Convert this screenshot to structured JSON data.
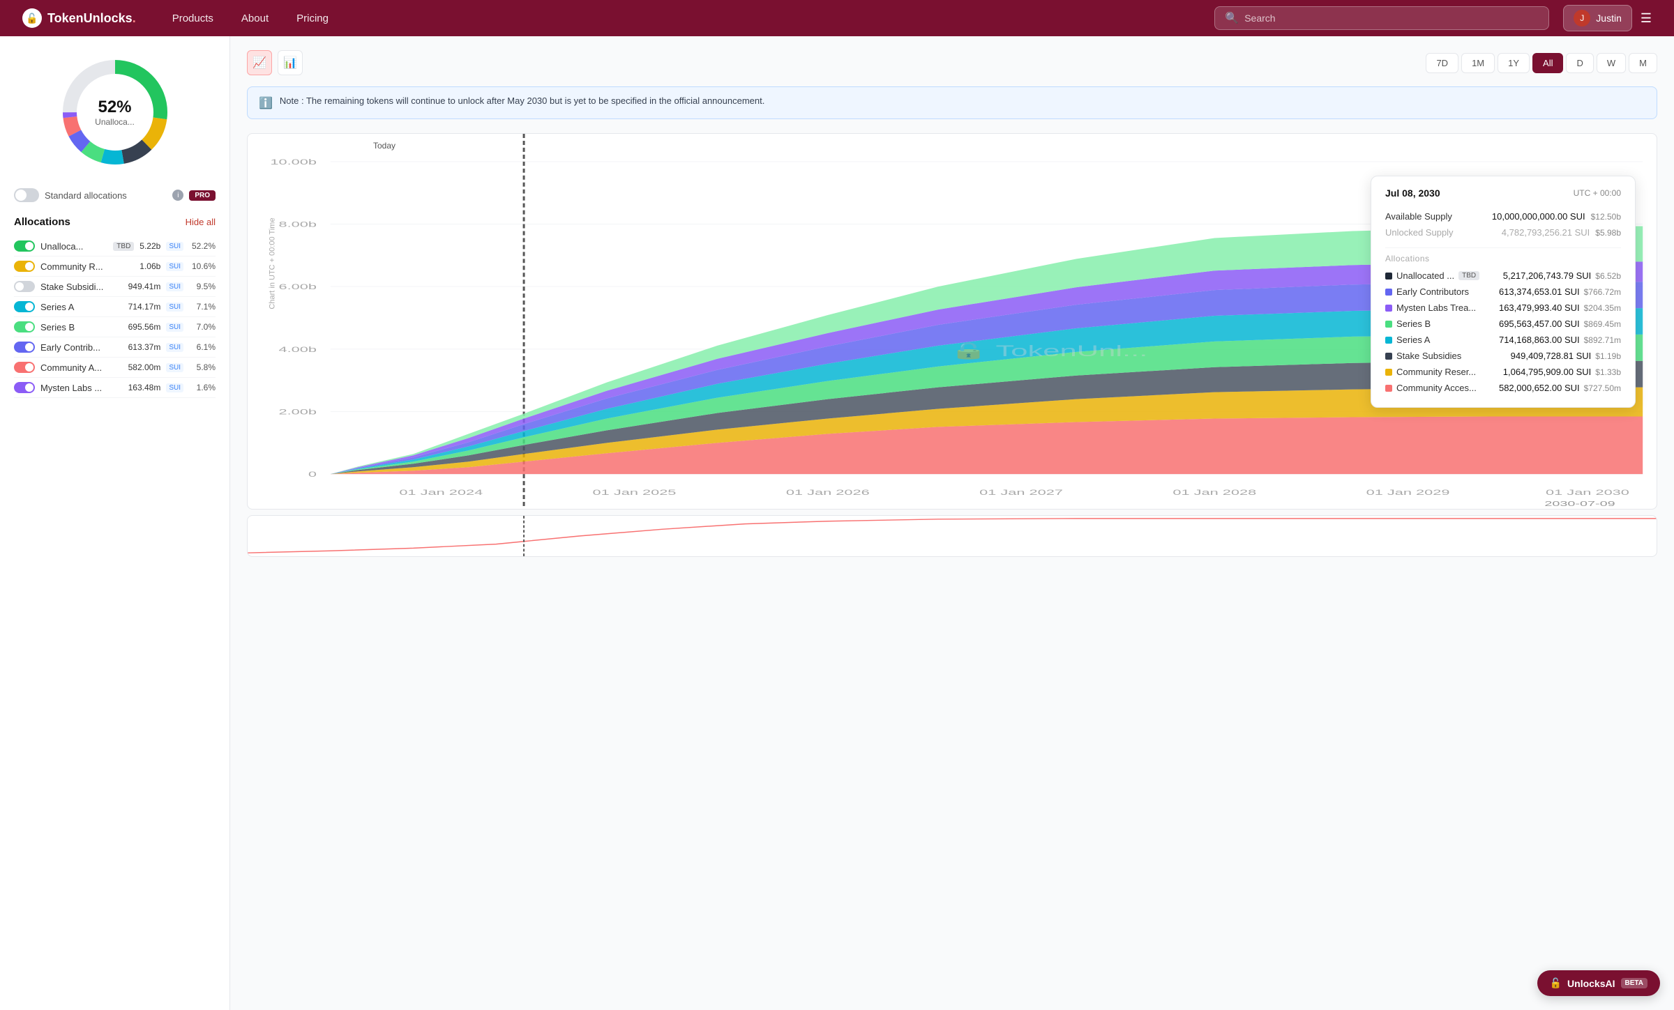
{
  "brand": {
    "name_token": "Token",
    "name_unlocks": "Unlocks",
    "dot": "."
  },
  "nav": {
    "links": [
      {
        "label": "Products",
        "id": "products"
      },
      {
        "label": "About",
        "id": "about"
      },
      {
        "label": "Pricing",
        "id": "pricing"
      }
    ],
    "search_placeholder": "Search",
    "user_name": "Justin"
  },
  "sidebar": {
    "donut_pct": "52%",
    "donut_label": "Unalloca...",
    "std_alloc_label": "Standard allocations",
    "pro_label": "PRO",
    "alloc_title": "Allocations",
    "hide_all_label": "Hide all",
    "items": [
      {
        "name": "Unalloca...",
        "tbd": true,
        "amount": "5.22b",
        "sui": "SUI",
        "pct": "52.2%",
        "color": "#22c55e",
        "color2": "#86efac",
        "on": true
      },
      {
        "name": "Community R...",
        "tbd": false,
        "amount": "1.06b",
        "sui": "SUI",
        "pct": "10.6%",
        "color": "#eab308",
        "color2": "#fde047",
        "on": true
      },
      {
        "name": "Stake Subsidi...",
        "tbd": false,
        "amount": "949.41m",
        "sui": "SUI",
        "pct": "9.5%",
        "color": "#374151",
        "color2": "#6b7280",
        "on": false
      },
      {
        "name": "Series A",
        "tbd": false,
        "amount": "714.17m",
        "sui": "SUI",
        "pct": "7.1%",
        "color": "#06b6d4",
        "color2": "#67e8f9",
        "on": true
      },
      {
        "name": "Series B",
        "tbd": false,
        "amount": "695.56m",
        "sui": "SUI",
        "pct": "7.0%",
        "color": "#4ade80",
        "color2": "#86efac",
        "on": true
      },
      {
        "name": "Early Contrib...",
        "tbd": false,
        "amount": "613.37m",
        "sui": "SUI",
        "pct": "6.1%",
        "color": "#6366f1",
        "color2": "#a5b4fc",
        "on": true
      },
      {
        "name": "Community A...",
        "tbd": false,
        "amount": "582.00m",
        "sui": "SUI",
        "pct": "5.8%",
        "color": "#f87171",
        "color2": "#fca5a5",
        "on": true
      },
      {
        "name": "Mysten Labs ...",
        "tbd": false,
        "amount": "163.48m",
        "sui": "SUI",
        "pct": "1.6%",
        "color": "#8b5cf6",
        "color2": "#c4b5fd",
        "on": true
      }
    ]
  },
  "chart": {
    "toolbar_icons": [
      {
        "id": "line",
        "symbol": "📈",
        "active": true
      },
      {
        "id": "bar",
        "symbol": "📊",
        "active": false
      }
    ],
    "time_buttons": [
      "7D",
      "1M",
      "1Y",
      "All",
      "D",
      "W",
      "M"
    ],
    "active_time": "All",
    "note_text": "Note :  The remaining tokens will continue to unlock after May 2030 but is yet to be specified in the official announcement.",
    "today_label": "Today",
    "utc_label": "Chart in UTC + 00:00 Time",
    "x_labels": [
      "01 Jan 2024",
      "01 Jan 2025",
      "01 Jan 2026",
      "01 Jan 2027",
      "01 Jan 2028",
      "01 Jan 2029",
      "01 Jan 2030"
    ],
    "y_labels": [
      "0",
      "2.00b",
      "4.00b",
      "6.00b",
      "8.00b",
      "10.00b"
    ],
    "watermark": "TokenUnl...",
    "date_label": "2030-07-09"
  },
  "tooltip": {
    "date": "Jul 08, 2030",
    "utc": "UTC + 00:00",
    "available_supply_label": "Available Supply",
    "available_supply_val": "10,000,000,000.00 SUI",
    "available_supply_usd": "$12.50b",
    "unlocked_supply_label": "Unlocked Supply",
    "unlocked_supply_val": "4,782,793,256.21 SUI",
    "unlocked_supply_usd": "$5.98b",
    "alloc_section_label": "Allocations",
    "alloc_rows": [
      {
        "name": "Unallocated ...",
        "tbd": true,
        "val": "5,217,206,743.79 SUI",
        "usd": "$6.52b",
        "color": "#1f2937"
      },
      {
        "name": "Early Contributors",
        "tbd": false,
        "val": "613,374,653.01 SUI",
        "usd": "$766.72m",
        "color": "#6366f1"
      },
      {
        "name": "Mysten Labs Trea...",
        "tbd": false,
        "val": "163,479,993.40 SUI",
        "usd": "$204.35m",
        "color": "#8b5cf6"
      },
      {
        "name": "Series B",
        "tbd": false,
        "val": "695,563,457.00 SUI",
        "usd": "$869.45m",
        "color": "#4ade80"
      },
      {
        "name": "Series A",
        "tbd": false,
        "val": "714,168,863.00 SUI",
        "usd": "$892.71m",
        "color": "#06b6d4"
      },
      {
        "name": "Stake Subsidies",
        "tbd": false,
        "val": "949,409,728.81 SUI",
        "usd": "$1.19b",
        "color": "#374151"
      },
      {
        "name": "Community Reser...",
        "tbd": false,
        "val": "1,064,795,909.00 SUI",
        "usd": "$1.33b",
        "color": "#eab308"
      },
      {
        "name": "Community Acces...",
        "tbd": false,
        "val": "582,000,652.00 SUI",
        "usd": "$727.50m",
        "color": "#f87171"
      }
    ]
  },
  "unlocks_ai": {
    "label": "UnlocksAI",
    "badge": "BETA"
  }
}
